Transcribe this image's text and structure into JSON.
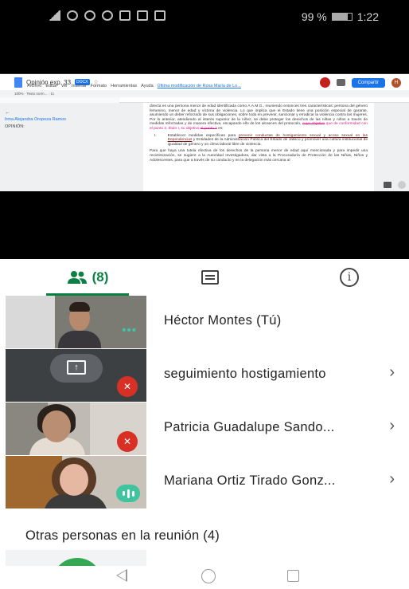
{
  "status_bar": {
    "battery": "99 %",
    "time": "1:22"
  },
  "shared_doc": {
    "title": "Opinión exp. 33",
    "badge": "DOCX",
    "menu": [
      "Archivo",
      "Editar",
      "Ver",
      "Insertar",
      "Formato",
      "Herramientas",
      "Ayuda"
    ],
    "last_edit": "Última modificación de Rosa María de Lo...",
    "share_label": "Compartir",
    "avatar_letter": "H",
    "toolbar_text": "100%  ·  Texto norm...  ·  11",
    "side_name": "Irma Alejandra Oropeza Ramos",
    "side_label": "OPINIÓN:",
    "para1": "directa es una persona menor de edad identificada como A.A.M.G., reuniendo entonces tres características: persona del género femenino, menor de edad y víctima de violencia. Lo que implica que el Estado tiene una posición especial de garante, asumiendo un deber reforzado de sus obligaciones, sobre todo en prevenir, sancionar y erradicar la violencia contra las mujeres. Por lo anterior, atendiendo al interés superior de la niñez, se debe proteger los derechos de las niñas y niños a través de medidas reforzadas y de manera efectiva, escapando ello de los alcances del protocolo,",
    "para1_strike": "cuyo objetivo",
    "para1_insert": "que de conformidad con el punto 2, título I, su objetivo",
    "para1_strike2": "el punto 2",
    "para1_end": "es:",
    "item_num": "I.",
    "item_pre": "Establecer medidas específicas para",
    "item_link": "prevenir conductas de hostigamiento sexual y acoso sexual en las Dependencias",
    "item_post": "y Entidades de la Administración Pública del Estado de Jalisco y promover una cultura institucional de igualdad de género y un clima laboral libre de violencia.",
    "para2": "Para que haya una tutela efectiva de los derechos de la persona menor de edad aquí mencionada y para impedir una revictimización, se sugiere a la Autoridad Investigadora, dar vista a la Procuraduría de Protección de las Niñas, Niños y Adolescentes, para que a través de su conducto y en la delegación más cercana al"
  },
  "tabs": {
    "people_count": "(8)",
    "people_icon": "people-icon",
    "chat_icon": "chat-icon",
    "info_icon": "info-icon"
  },
  "participants": [
    {
      "name": "Héctor Montes (Tú)",
      "status": "more-options"
    },
    {
      "name": "seguimiento hostigamiento",
      "status": "muted"
    },
    {
      "name": "Patricia Guadalupe Sando...",
      "status": "muted"
    },
    {
      "name": "Mariana Ortiz Tirado Gonz...",
      "status": "speaking"
    }
  ],
  "others_label": "Otras personas en la reunión (4)",
  "colors": {
    "accent": "#0b8043",
    "muted_red": "#d93025",
    "speaking_teal": "#40c4a0"
  }
}
